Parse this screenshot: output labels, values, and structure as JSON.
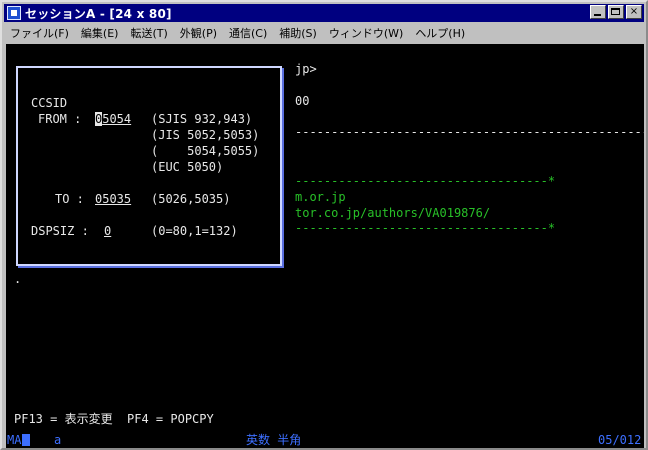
{
  "window": {
    "title": "セッションA - [24 x 80]",
    "buttons": {
      "minimize": "_",
      "maximize": "□",
      "close": "×"
    }
  },
  "menu": [
    "ファイル(F)",
    "編集(E)",
    "転送(T)",
    "外観(P)",
    "通信(C)",
    "補助(S)",
    "ウィンドウ(W)",
    "ヘルプ(H)"
  ],
  "terminal": {
    "prompt_tail": "jp>",
    "line_00": "00",
    "dash_line": "---------------------------------------------------",
    "green_dash_top": "-----------------------------------*",
    "green_host": "m.or.jp",
    "green_url": "tor.co.jp/authors/VA019876/",
    "green_dash_bottom": "-----------------------------------*",
    "stray_dot": ".",
    "pf_line": "PF13 = 表示変更  PF4 = POPCPY"
  },
  "dialog": {
    "heading": "CCSID",
    "from_label": "FROM :",
    "from_value": "05054",
    "from_value_first": "0",
    "from_value_rest": "5054",
    "from_hint_1": "(SJIS 932,943)",
    "from_hint_2": "(JIS 5052,5053)",
    "from_hint_3": "(    5054,5055)",
    "from_hint_4": "(EUC 5050)",
    "to_label": "TO :",
    "to_value": "05035",
    "to_hint": "(5026,5035)",
    "dspsiz_label": "DSPSIZ :",
    "dspsiz_value": "0",
    "dspsiz_hint": "(0=80,1=132)"
  },
  "statusbar": {
    "mode": "MA",
    "indicator": "a",
    "input_mode": "英数 半角",
    "position": "05/012"
  },
  "colors": {
    "title_bar": "#000080",
    "terminal_bg": "#000000",
    "text_white": "#e8e8e8",
    "text_green": "#28c028",
    "status_blue": "#3d6fff",
    "dialog_shadow": "#5a6fe0"
  }
}
